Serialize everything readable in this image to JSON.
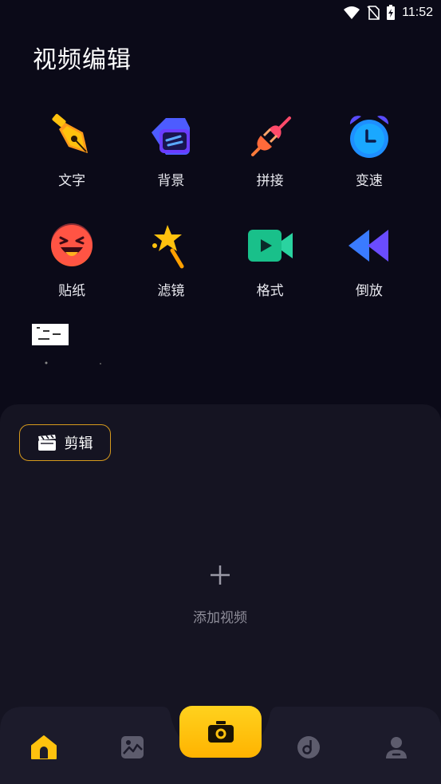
{
  "status_bar": {
    "time": "11:52"
  },
  "header": {
    "title": "视频编辑"
  },
  "tools": [
    {
      "label": "文字",
      "icon": "pen-nib-icon"
    },
    {
      "label": "背景",
      "icon": "background-icon"
    },
    {
      "label": "拼接",
      "icon": "plug-icon"
    },
    {
      "label": "变速",
      "icon": "alarm-clock-icon"
    },
    {
      "label": "贴纸",
      "icon": "sticker-face-icon"
    },
    {
      "label": "滤镜",
      "icon": "magic-wand-icon"
    },
    {
      "label": "格式",
      "icon": "video-camera-icon"
    },
    {
      "label": "倒放",
      "icon": "rewind-icon"
    }
  ],
  "panel": {
    "edit_chip_label": "剪辑",
    "add_video_label": "添加视频"
  },
  "tabbar": {
    "items": [
      "home-icon",
      "gallery-icon",
      "camera-icon",
      "music-icon",
      "profile-icon"
    ],
    "active": "home-icon"
  },
  "colors": {
    "background": "#0b0a18",
    "panel": "#151422",
    "accent": "#ffc20e",
    "chip_border": "#d69a1d"
  }
}
